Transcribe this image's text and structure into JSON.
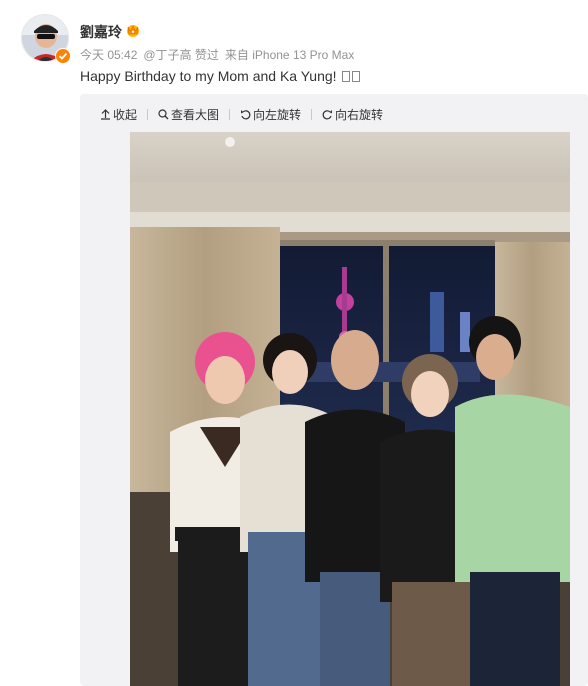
{
  "post": {
    "username": "劉嘉玲",
    "time": "今天 05:42",
    "via_user": "@丁子高 赞过",
    "device": "来自 iPhone 13 Pro Max",
    "text": "Happy Birthday to my Mom and Ka Yung!"
  },
  "toolbar": {
    "collapse": "收起",
    "view_large": "查看大图",
    "rotate_left": "向左旋转",
    "rotate_right": "向右旋转"
  },
  "icons": [
    "avatar",
    "verified-badge-icon",
    "crown-icon",
    "collapse-icon",
    "magnifier-icon",
    "rotate-left-icon",
    "rotate-right-icon"
  ],
  "colors": {
    "accent": "#ff8200",
    "meta": "#939393",
    "panel": "#f2f2f5"
  }
}
